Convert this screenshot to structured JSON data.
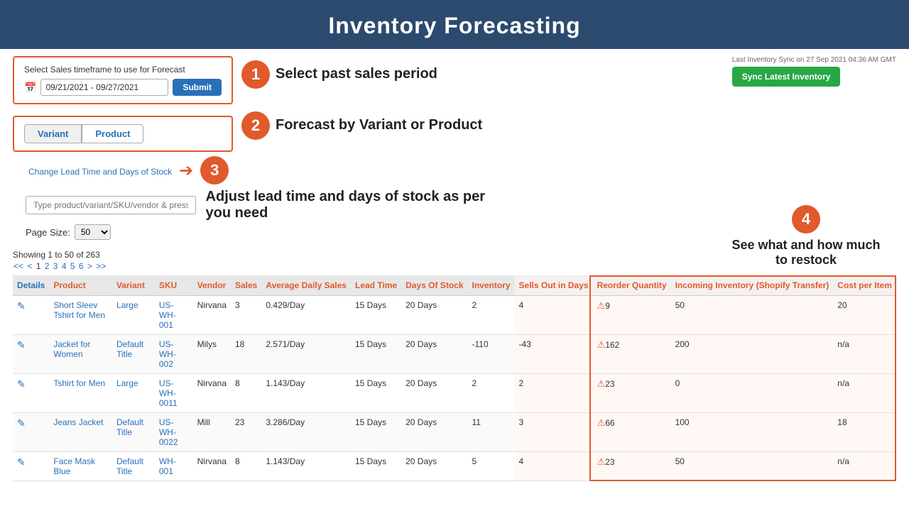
{
  "header": {
    "title": "Inventory Forecasting"
  },
  "controls": {
    "sales_label": "Select Sales timeframe to use for Forecast",
    "date_value": "09/21/2021 - 09/27/2021",
    "submit_label": "Submit",
    "sync_note": "Last Inventory Sync on 27 Sep 2021 04:36 AM GMT",
    "sync_label": "Sync Latest Inventory",
    "tab_variant": "Variant",
    "tab_product": "Product",
    "change_lead_label": "Change Lead Time and Days of Stock",
    "filter_placeholder": "Type product/variant/SKU/vendor & press Enter to filter results",
    "page_size_label": "Page Size:",
    "page_size_value": "50"
  },
  "annotations": {
    "step1_circle": "1",
    "step1_text": "Select past sales period",
    "step2_circle": "2",
    "step2_text": "Forecast  by Variant or Product",
    "step3_circle": "3",
    "step3_text": "Adjust lead time and days of stock as per you need",
    "step4_circle": "4",
    "step4_text": "See what and how much to restock"
  },
  "table": {
    "showing": "Showing 1 to 50 of 263",
    "pagination": "<< < 1 2 3 4 5 6 > >>",
    "columns": [
      "Details",
      "Product",
      "Variant",
      "SKU",
      "Vendor",
      "Sales",
      "Average Daily Sales",
      "Lead Time",
      "Days Of Stock",
      "Inventory",
      "Sells Out in Days",
      "Reorder Quantity",
      "Incoming Inventory (Shopify Transfer)",
      "Cost per Item"
    ],
    "rows": [
      {
        "product": "Short Sleev Tshirt for Men",
        "variant": "Large",
        "sku": "US-WH-001",
        "vendor": "Nirvana",
        "sales": "3",
        "avg_daily": "0.429/Day",
        "lead_time": "15 Days",
        "days_stock": "20 Days",
        "inventory": "2",
        "sells_out": "4",
        "reorder_qty": "9",
        "incoming": "50",
        "cost": "20"
      },
      {
        "product": "Jacket for Women",
        "variant": "Default Title",
        "sku": "US-WH-002",
        "vendor": "Milys",
        "sales": "18",
        "avg_daily": "2.571/Day",
        "lead_time": "15 Days",
        "days_stock": "20 Days",
        "inventory": "-110",
        "sells_out": "-43",
        "reorder_qty": "162",
        "incoming": "200",
        "cost": "n/a"
      },
      {
        "product": "Tshirt for Men",
        "variant": "Large",
        "sku": "US-WH-0011",
        "vendor": "Nirvana",
        "sales": "8",
        "avg_daily": "1.143/Day",
        "lead_time": "15 Days",
        "days_stock": "20 Days",
        "inventory": "2",
        "sells_out": "2",
        "reorder_qty": "23",
        "incoming": "0",
        "cost": "n/a"
      },
      {
        "product": "Jeans Jacket",
        "variant": "Default Title",
        "sku": "US-WH-0022",
        "vendor": "Mill",
        "sales": "23",
        "avg_daily": "3.286/Day",
        "lead_time": "15 Days",
        "days_stock": "20 Days",
        "inventory": "11",
        "sells_out": "3",
        "reorder_qty": "66",
        "incoming": "100",
        "cost": "18"
      },
      {
        "product": "Face Mask Blue",
        "variant": "Default Title",
        "sku": "WH-001",
        "vendor": "Nirvana",
        "sales": "8",
        "avg_daily": "1.143/Day",
        "lead_time": "15 Days",
        "days_stock": "20 Days",
        "inventory": "5",
        "sells_out": "4",
        "reorder_qty": "23",
        "incoming": "50",
        "cost": "n/a"
      }
    ]
  }
}
